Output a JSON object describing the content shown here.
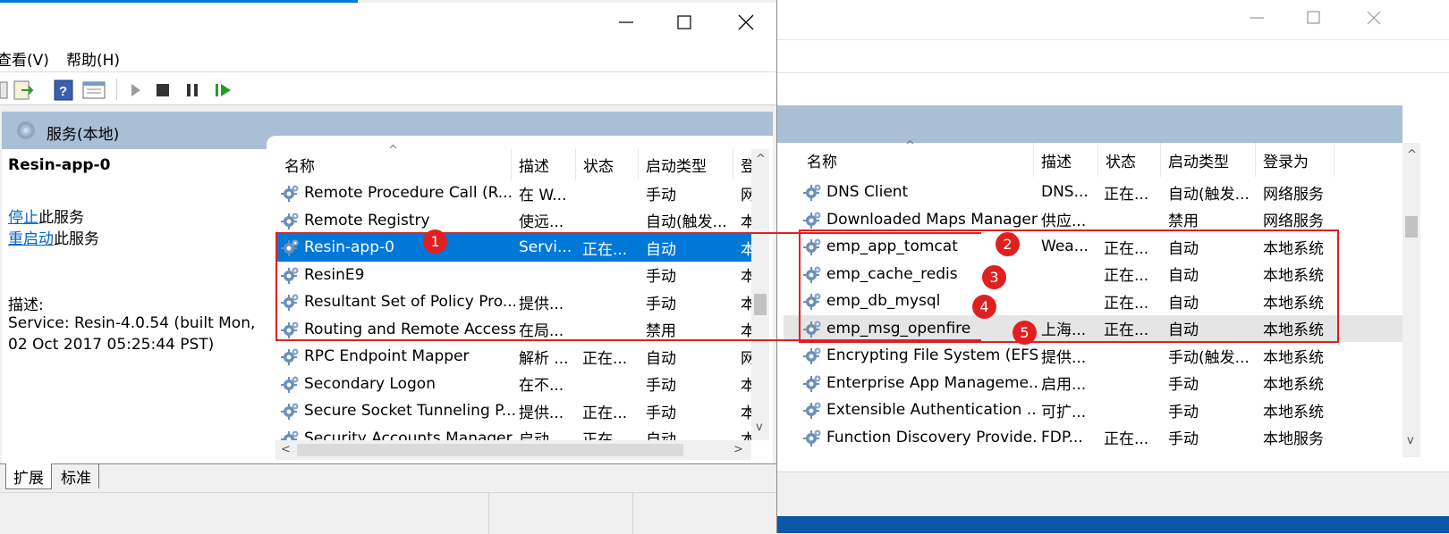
{
  "left_window": {
    "menu": [
      {
        "label": "查看(V)"
      },
      {
        "label": "帮助(H)"
      }
    ],
    "panel_title": "服务(本地)",
    "detail": {
      "service_name": "Resin-app-0",
      "stop_link": "停止",
      "stop_rest": "此服务",
      "restart_link": "重启动",
      "restart_rest": "此服务",
      "desc_label": "描述:",
      "desc_line1": "Service: Resin-4.0.54 (built Mon,",
      "desc_line2": "02 Oct 2017 05:25:44 PST)"
    },
    "columns": [
      "名称",
      "描述",
      "状态",
      "启动类型",
      "登"
    ],
    "rows": [
      {
        "name": "Remote Procedure Call (R...",
        "desc": "在 W...",
        "status": "",
        "startup": "手动",
        "logon": "网"
      },
      {
        "name": "Remote Registry",
        "desc": "使远...",
        "status": "",
        "startup": "自动(触发...",
        "logon": "本"
      },
      {
        "name": "Resin-app-0",
        "desc": "Servi...",
        "status": "正在...",
        "startup": "自动",
        "logon": "本"
      },
      {
        "name": "ResinE9",
        "desc": "",
        "status": "",
        "startup": "手动",
        "logon": "本"
      },
      {
        "name": "Resultant Set of Policy Pro...",
        "desc": "提供...",
        "status": "",
        "startup": "手动",
        "logon": "本"
      },
      {
        "name": "Routing and Remote Access",
        "desc": "在局...",
        "status": "",
        "startup": "禁用",
        "logon": "本"
      },
      {
        "name": "RPC Endpoint Mapper",
        "desc": "解析 ...",
        "status": "正在...",
        "startup": "自动",
        "logon": "网"
      },
      {
        "name": "Secondary Logon",
        "desc": "在不...",
        "status": "",
        "startup": "手动",
        "logon": "本"
      },
      {
        "name": "Secure Socket Tunneling P...",
        "desc": "提供...",
        "status": "正在...",
        "startup": "手动",
        "logon": "本"
      },
      {
        "name": "Security Accounts Manager",
        "desc": "启动...",
        "status": "正在...",
        "startup": "自动",
        "logon": "本"
      }
    ],
    "tabs": [
      "扩展",
      "标准"
    ],
    "badge": "1"
  },
  "right_window": {
    "columns": [
      "名称",
      "描述",
      "状态",
      "启动类型",
      "登录为"
    ],
    "rows": [
      {
        "name": "DNS Client",
        "desc": "DNS...",
        "status": "正在...",
        "startup": "自动(触发...",
        "logon": "网络服务"
      },
      {
        "name": "Downloaded Maps Manager",
        "desc": "供应...",
        "status": "",
        "startup": "禁用",
        "logon": "网络服务"
      },
      {
        "name": "emp_app_tomcat",
        "desc": "Wea...",
        "status": "正在...",
        "startup": "自动",
        "logon": "本地系统"
      },
      {
        "name": "emp_cache_redis",
        "desc": "",
        "status": "正在...",
        "startup": "自动",
        "logon": "本地系统"
      },
      {
        "name": "emp_db_mysql",
        "desc": "",
        "status": "正在...",
        "startup": "自动",
        "logon": "本地系统"
      },
      {
        "name": "emp_msg_openfire",
        "desc": "上海...",
        "status": "正在...",
        "startup": "自动",
        "logon": "本地系统"
      },
      {
        "name": "Encrypting File System (EFS)",
        "desc": "提供...",
        "status": "",
        "startup": "手动(触发...",
        "logon": "本地系统"
      },
      {
        "name": "Enterprise App Manageme...",
        "desc": "启用...",
        "status": "",
        "startup": "手动",
        "logon": "本地系统"
      },
      {
        "name": "Extensible Authentication ...",
        "desc": "可扩...",
        "status": "",
        "startup": "手动",
        "logon": "本地系统"
      },
      {
        "name": "Function Discovery Provide...",
        "desc": "FDP...",
        "status": "正在...",
        "startup": "手动",
        "logon": "本地服务"
      }
    ],
    "badges": [
      "2",
      "3",
      "4",
      "5"
    ]
  },
  "colors": {
    "selection": "#0078d7",
    "annotation": "#e02020",
    "panel_header": "#a9bfd6",
    "link": "#0066cc"
  }
}
